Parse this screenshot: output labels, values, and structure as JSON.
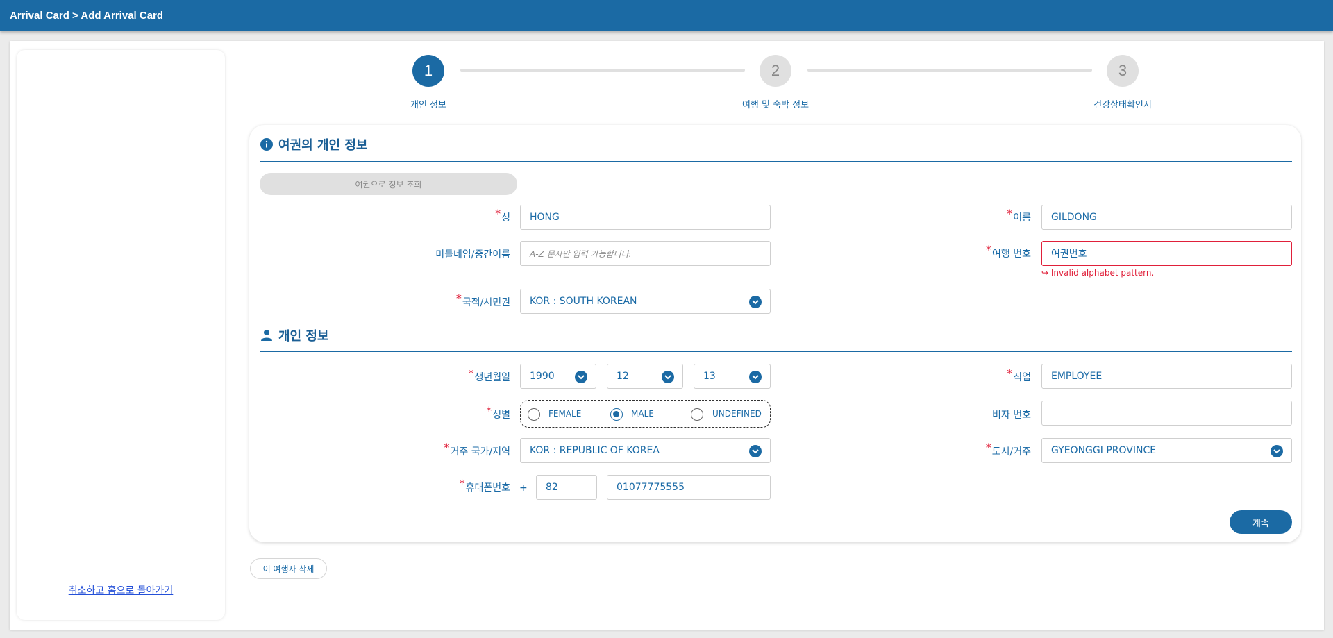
{
  "header": {
    "breadcrumb": "Arrival Card > Add Arrival Card"
  },
  "sidebar": {
    "back_link": "취소하고 홈으로 돌아가기"
  },
  "stepper": {
    "steps": [
      {
        "number": "1",
        "label": "개인 정보"
      },
      {
        "number": "2",
        "label": "여행 및 숙박 정보"
      },
      {
        "number": "3",
        "label": "건강상태확인서"
      }
    ],
    "current_step": 1
  },
  "passport_section": {
    "title": "여권의 개인 정보",
    "icon": "info-icon",
    "lookup_button": "여권으로 정보 조회",
    "surname": {
      "label": "성",
      "value": "HONG"
    },
    "given_name": {
      "label": "이름",
      "value": "GILDONG"
    },
    "middle_name": {
      "label": "미들네임/중간이름",
      "placeholder": "A-Z 문자만 입력 가능합니다."
    },
    "travel_number": {
      "label": "여행 번호",
      "value": "여권번호",
      "error": "↪ Invalid alphabet pattern."
    },
    "nationality": {
      "label": "국적/시민권",
      "value": "KOR : SOUTH KOREAN"
    }
  },
  "personal_section": {
    "title": "개인 정보",
    "icon": "person-icon",
    "birthdate": {
      "label": "생년월일",
      "year": "1990",
      "month": "12",
      "day": "13"
    },
    "occupation": {
      "label": "직업",
      "value": "EMPLOYEE"
    },
    "gender": {
      "label": "성별",
      "options": [
        "FEMALE",
        "MALE",
        "UNDEFINED"
      ],
      "selected": "MALE"
    },
    "visa_number": {
      "label": "비자 번호",
      "value": ""
    },
    "residence_country": {
      "label": "거주 국가/지역",
      "value": "KOR : REPUBLIC OF KOREA"
    },
    "city": {
      "label": "도시/거주",
      "value": "GYEONGGI PROVINCE"
    },
    "phone": {
      "label": "휴대폰번호",
      "prefix": "+",
      "country_code": "82",
      "number": "01077775555"
    }
  },
  "actions": {
    "next": "계속",
    "delete_traveler": "이 여행자 삭제"
  },
  "colors": {
    "primary": "#1b6aa4",
    "error": "#e0203a",
    "link": "#2450d8"
  }
}
